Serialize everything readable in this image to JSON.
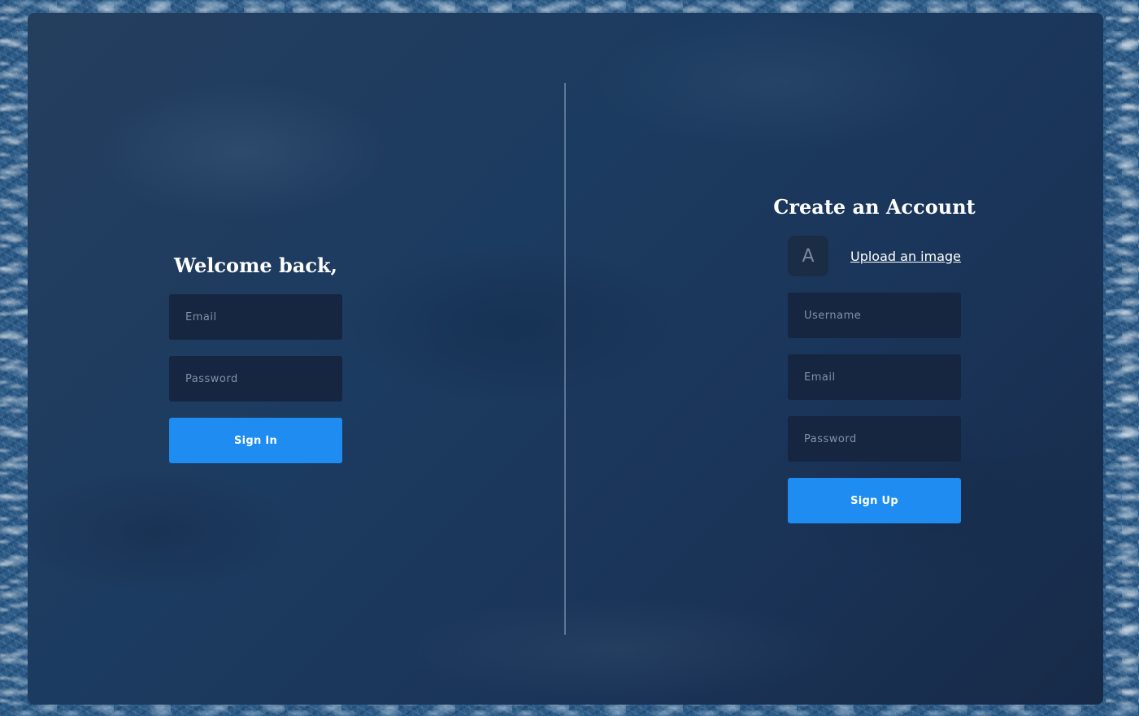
{
  "sign_in": {
    "heading": "Welcome back,",
    "email_placeholder": "Email",
    "password_placeholder": "Password",
    "submit_label": "Sign In"
  },
  "sign_up": {
    "heading": "Create an Account",
    "avatar_initial": "A",
    "upload_label": "Upload an image",
    "username_placeholder": "Username",
    "email_placeholder": "Email",
    "password_placeholder": "Password",
    "submit_label": "Sign Up"
  },
  "colors": {
    "accent": "#1e8cf0",
    "field_bg": "#162640",
    "card_bg": "#1c3b60"
  }
}
